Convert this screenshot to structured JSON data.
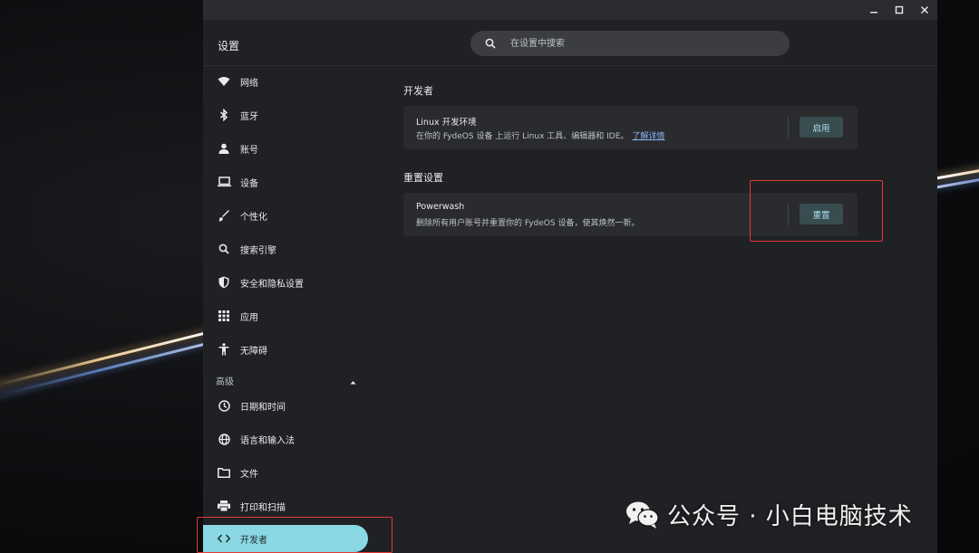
{
  "window": {
    "controls": {
      "minimize_icon": "minimize-icon",
      "maximize_icon": "maximize-icon",
      "close_icon": "close-icon"
    }
  },
  "header": {
    "title": "设置",
    "search": {
      "placeholder": "在设置中搜索",
      "icon": "search-icon"
    }
  },
  "sidebar": {
    "items": [
      {
        "label": "网络",
        "icon": "wifi-icon"
      },
      {
        "label": "蓝牙",
        "icon": "bluetooth-icon"
      },
      {
        "label": "账号",
        "icon": "person-icon"
      },
      {
        "label": "设备",
        "icon": "laptop-icon"
      },
      {
        "label": "个性化",
        "icon": "brush-icon"
      },
      {
        "label": "搜索引擎",
        "icon": "search-icon"
      },
      {
        "label": "安全和隐私设置",
        "icon": "shield-icon"
      },
      {
        "label": "应用",
        "icon": "apps-grid-icon"
      },
      {
        "label": "无障碍",
        "icon": "accessibility-icon"
      }
    ],
    "advanced_label": "高级",
    "advanced_items": [
      {
        "label": "日期和时间",
        "icon": "clock-icon"
      },
      {
        "label": "语言和输入法",
        "icon": "globe-icon"
      },
      {
        "label": "文件",
        "icon": "folder-icon"
      },
      {
        "label": "打印和扫描",
        "icon": "printer-icon"
      },
      {
        "label": "开发者",
        "icon": "code-icon",
        "active": true
      }
    ]
  },
  "main": {
    "developer": {
      "section_title": "开发者",
      "card": {
        "title": "Linux 开发环境",
        "description": "在你的 FydeOS 设备 上运行 Linux 工具、编辑器和 IDE。",
        "link": "了解详情",
        "button": "启用"
      }
    },
    "reset": {
      "section_title": "重置设置",
      "card": {
        "title": "Powerwash",
        "description": "删除所有用户账号并重置你的 FydeOS 设备，使其焕然一新。",
        "button": "重置"
      }
    }
  },
  "watermark": {
    "text": "公众号 · 小白电脑技术",
    "icon": "wechat-icon"
  },
  "colors": {
    "window_bg": "#202124",
    "card_bg": "#2a2b2e",
    "accent": "#8ad8e4",
    "button_bg": "#394c50",
    "button_text": "#a6e3ec",
    "link": "#8ab4f8",
    "highlight": "#e53935"
  }
}
